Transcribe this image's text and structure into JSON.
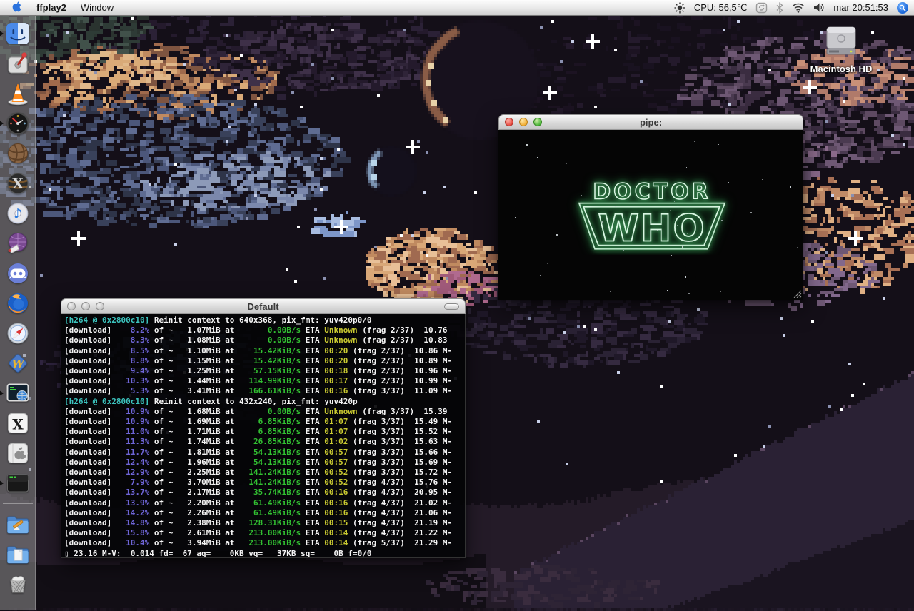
{
  "menubar": {
    "menus": [
      "ffplay2",
      "Window"
    ],
    "status": {
      "cpu": "CPU: 56,5℃",
      "clock": "mar 20:51:53"
    },
    "status_icons": [
      "brightness",
      "sync",
      "bluetooth",
      "wifi",
      "volume",
      "spotlight"
    ]
  },
  "desktop": {
    "hd_label": "Macintosh HD"
  },
  "dock": {
    "items": [
      "finder",
      "lever-app",
      "vlc",
      "gauge-monitor",
      "wicker-ball",
      "osx-tiger-x",
      "itunes",
      "purple-globe",
      "discord",
      "firefox",
      "safari",
      "w-app",
      "network-terminal",
      "x11",
      "apple-utility",
      "terminal",
      "applications-folder",
      "documents-folder",
      "trash"
    ],
    "running": [
      "finder",
      "gauge-monitor",
      "network-terminal",
      "terminal"
    ]
  },
  "terminal": {
    "title": "Default",
    "lines": [
      [
        {
          "t": "[h264 @ 0x2800c10]",
          "c": "c"
        },
        {
          "t": " Reinit context to 640x368, pix_fmt: yuv420p0/0",
          "c": "w"
        }
      ],
      [
        {
          "t": "[download] ",
          "c": "w"
        },
        {
          "t": "   8.2%",
          "c": "p"
        },
        {
          "t": " of ~ ",
          "c": "w"
        },
        {
          "t": "  1.07MiB",
          "c": "w"
        },
        {
          "t": " at ",
          "c": "w"
        },
        {
          "t": "      0.00B/s",
          "c": "g"
        },
        {
          "t": " ETA ",
          "c": "w"
        },
        {
          "t": "Unknown",
          "c": "y"
        },
        {
          "t": " (frag 2/37)  10.76",
          "c": "w"
        }
      ],
      [
        {
          "t": "[download] ",
          "c": "w"
        },
        {
          "t": "   8.3%",
          "c": "p"
        },
        {
          "t": " of ~ ",
          "c": "w"
        },
        {
          "t": "  1.08MiB",
          "c": "w"
        },
        {
          "t": " at ",
          "c": "w"
        },
        {
          "t": "      0.00B/s",
          "c": "g"
        },
        {
          "t": " ETA ",
          "c": "w"
        },
        {
          "t": "Unknown",
          "c": "y"
        },
        {
          "t": " (frag 2/37)  10.83",
          "c": "w"
        }
      ],
      [
        {
          "t": "[download] ",
          "c": "w"
        },
        {
          "t": "   8.5%",
          "c": "p"
        },
        {
          "t": " of ~ ",
          "c": "w"
        },
        {
          "t": "  1.10MiB",
          "c": "w"
        },
        {
          "t": " at ",
          "c": "w"
        },
        {
          "t": "   15.42KiB/s",
          "c": "g"
        },
        {
          "t": " ETA ",
          "c": "w"
        },
        {
          "t": "00:20",
          "c": "y"
        },
        {
          "t": " (frag 2/37)  10.86 M-",
          "c": "w"
        }
      ],
      [
        {
          "t": "[download] ",
          "c": "w"
        },
        {
          "t": "   8.8%",
          "c": "p"
        },
        {
          "t": " of ~ ",
          "c": "w"
        },
        {
          "t": "  1.15MiB",
          "c": "w"
        },
        {
          "t": " at ",
          "c": "w"
        },
        {
          "t": "   15.42KiB/s",
          "c": "g"
        },
        {
          "t": " ETA ",
          "c": "w"
        },
        {
          "t": "00:20",
          "c": "y"
        },
        {
          "t": " (frag 2/37)  10.89 M-",
          "c": "w"
        }
      ],
      [
        {
          "t": "[download] ",
          "c": "w"
        },
        {
          "t": "   9.4%",
          "c": "p"
        },
        {
          "t": " of ~ ",
          "c": "w"
        },
        {
          "t": "  1.25MiB",
          "c": "w"
        },
        {
          "t": " at ",
          "c": "w"
        },
        {
          "t": "   57.15KiB/s",
          "c": "g"
        },
        {
          "t": " ETA ",
          "c": "w"
        },
        {
          "t": "00:18",
          "c": "y"
        },
        {
          "t": " (frag 2/37)  10.96 M-",
          "c": "w"
        }
      ],
      [
        {
          "t": "[download] ",
          "c": "w"
        },
        {
          "t": "  10.3%",
          "c": "p"
        },
        {
          "t": " of ~ ",
          "c": "w"
        },
        {
          "t": "  1.44MiB",
          "c": "w"
        },
        {
          "t": " at ",
          "c": "w"
        },
        {
          "t": "  114.99KiB/s",
          "c": "g"
        },
        {
          "t": " ETA ",
          "c": "w"
        },
        {
          "t": "00:17",
          "c": "y"
        },
        {
          "t": " (frag 2/37)  10.99 M-",
          "c": "w"
        }
      ],
      [
        {
          "t": "[download] ",
          "c": "w"
        },
        {
          "t": "   5.3%",
          "c": "p"
        },
        {
          "t": " of ~ ",
          "c": "w"
        },
        {
          "t": "  3.41MiB",
          "c": "w"
        },
        {
          "t": " at ",
          "c": "w"
        },
        {
          "t": "  166.61KiB/s",
          "c": "g"
        },
        {
          "t": " ETA ",
          "c": "w"
        },
        {
          "t": "00:16",
          "c": "y"
        },
        {
          "t": " (frag 3/37)  11.09 M-",
          "c": "w"
        }
      ],
      [
        {
          "t": "[h264 @ 0x2800c10]",
          "c": "c"
        },
        {
          "t": " Reinit context to 432x240, pix_fmt: yuv420p",
          "c": "w"
        }
      ],
      [
        {
          "t": "[download] ",
          "c": "w"
        },
        {
          "t": "  10.9%",
          "c": "p"
        },
        {
          "t": " of ~ ",
          "c": "w"
        },
        {
          "t": "  1.68MiB",
          "c": "w"
        },
        {
          "t": " at ",
          "c": "w"
        },
        {
          "t": "      0.00B/s",
          "c": "g"
        },
        {
          "t": " ETA ",
          "c": "w"
        },
        {
          "t": "Unknown",
          "c": "y"
        },
        {
          "t": " (frag 3/37)  15.39",
          "c": "w"
        }
      ],
      [
        {
          "t": "[download] ",
          "c": "w"
        },
        {
          "t": "  10.9%",
          "c": "p"
        },
        {
          "t": " of ~ ",
          "c": "w"
        },
        {
          "t": "  1.69MiB",
          "c": "w"
        },
        {
          "t": " at ",
          "c": "w"
        },
        {
          "t": "    6.85KiB/s",
          "c": "g"
        },
        {
          "t": " ETA ",
          "c": "w"
        },
        {
          "t": "01:07",
          "c": "y"
        },
        {
          "t": " (frag 3/37)  15.49 M-",
          "c": "w"
        }
      ],
      [
        {
          "t": "[download] ",
          "c": "w"
        },
        {
          "t": "  11.0%",
          "c": "p"
        },
        {
          "t": " of ~ ",
          "c": "w"
        },
        {
          "t": "  1.71MiB",
          "c": "w"
        },
        {
          "t": " at ",
          "c": "w"
        },
        {
          "t": "    6.85KiB/s",
          "c": "g"
        },
        {
          "t": " ETA ",
          "c": "w"
        },
        {
          "t": "01:07",
          "c": "y"
        },
        {
          "t": " (frag 3/37)  15.52 M-",
          "c": "w"
        }
      ],
      [
        {
          "t": "[download] ",
          "c": "w"
        },
        {
          "t": "  11.3%",
          "c": "p"
        },
        {
          "t": " of ~ ",
          "c": "w"
        },
        {
          "t": "  1.74MiB",
          "c": "w"
        },
        {
          "t": " at ",
          "c": "w"
        },
        {
          "t": "   26.85KiB/s",
          "c": "g"
        },
        {
          "t": " ETA ",
          "c": "w"
        },
        {
          "t": "01:02",
          "c": "y"
        },
        {
          "t": " (frag 3/37)  15.63 M-",
          "c": "w"
        }
      ],
      [
        {
          "t": "[download] ",
          "c": "w"
        },
        {
          "t": "  11.7%",
          "c": "p"
        },
        {
          "t": " of ~ ",
          "c": "w"
        },
        {
          "t": "  1.81MiB",
          "c": "w"
        },
        {
          "t": " at ",
          "c": "w"
        },
        {
          "t": "   54.13KiB/s",
          "c": "g"
        },
        {
          "t": " ETA ",
          "c": "w"
        },
        {
          "t": "00:57",
          "c": "y"
        },
        {
          "t": " (frag 3/37)  15.66 M-",
          "c": "w"
        }
      ],
      [
        {
          "t": "[download] ",
          "c": "w"
        },
        {
          "t": "  12.4%",
          "c": "p"
        },
        {
          "t": " of ~ ",
          "c": "w"
        },
        {
          "t": "  1.96MiB",
          "c": "w"
        },
        {
          "t": " at ",
          "c": "w"
        },
        {
          "t": "   54.13KiB/s",
          "c": "g"
        },
        {
          "t": " ETA ",
          "c": "w"
        },
        {
          "t": "00:57",
          "c": "y"
        },
        {
          "t": " (frag 3/37)  15.69 M-",
          "c": "w"
        }
      ],
      [
        {
          "t": "[download] ",
          "c": "w"
        },
        {
          "t": "  12.9%",
          "c": "p"
        },
        {
          "t": " of ~ ",
          "c": "w"
        },
        {
          "t": "  2.25MiB",
          "c": "w"
        },
        {
          "t": " at ",
          "c": "w"
        },
        {
          "t": "  141.24KiB/s",
          "c": "g"
        },
        {
          "t": " ETA ",
          "c": "w"
        },
        {
          "t": "00:52",
          "c": "y"
        },
        {
          "t": " (frag 3/37)  15.72 M-",
          "c": "w"
        }
      ],
      [
        {
          "t": "[download] ",
          "c": "w"
        },
        {
          "t": "   7.9%",
          "c": "p"
        },
        {
          "t": " of ~ ",
          "c": "w"
        },
        {
          "t": "  3.70MiB",
          "c": "w"
        },
        {
          "t": " at ",
          "c": "w"
        },
        {
          "t": "  141.24KiB/s",
          "c": "g"
        },
        {
          "t": " ETA ",
          "c": "w"
        },
        {
          "t": "00:52",
          "c": "y"
        },
        {
          "t": " (frag 4/37)  15.76 M-",
          "c": "w"
        }
      ],
      [
        {
          "t": "[download] ",
          "c": "w"
        },
        {
          "t": "  13.7%",
          "c": "p"
        },
        {
          "t": " of ~ ",
          "c": "w"
        },
        {
          "t": "  2.17MiB",
          "c": "w"
        },
        {
          "t": " at ",
          "c": "w"
        },
        {
          "t": "   35.74KiB/s",
          "c": "g"
        },
        {
          "t": " ETA ",
          "c": "w"
        },
        {
          "t": "00:16",
          "c": "y"
        },
        {
          "t": " (frag 4/37)  20.95 M-",
          "c": "w"
        }
      ],
      [
        {
          "t": "[download] ",
          "c": "w"
        },
        {
          "t": "  13.9%",
          "c": "p"
        },
        {
          "t": " of ~ ",
          "c": "w"
        },
        {
          "t": "  2.20MiB",
          "c": "w"
        },
        {
          "t": " at ",
          "c": "w"
        },
        {
          "t": "   61.49KiB/s",
          "c": "g"
        },
        {
          "t": " ETA ",
          "c": "w"
        },
        {
          "t": "00:16",
          "c": "y"
        },
        {
          "t": " (frag 4/37)  21.02 M-",
          "c": "w"
        }
      ],
      [
        {
          "t": "[download] ",
          "c": "w"
        },
        {
          "t": "  14.2%",
          "c": "p"
        },
        {
          "t": " of ~ ",
          "c": "w"
        },
        {
          "t": "  2.26MiB",
          "c": "w"
        },
        {
          "t": " at ",
          "c": "w"
        },
        {
          "t": "   61.49KiB/s",
          "c": "g"
        },
        {
          "t": " ETA ",
          "c": "w"
        },
        {
          "t": "00:16",
          "c": "y"
        },
        {
          "t": " (frag 4/37)  21.06 M-",
          "c": "w"
        }
      ],
      [
        {
          "t": "[download] ",
          "c": "w"
        },
        {
          "t": "  14.8%",
          "c": "p"
        },
        {
          "t": " of ~ ",
          "c": "w"
        },
        {
          "t": "  2.38MiB",
          "c": "w"
        },
        {
          "t": " at ",
          "c": "w"
        },
        {
          "t": "  128.31KiB/s",
          "c": "g"
        },
        {
          "t": " ETA ",
          "c": "w"
        },
        {
          "t": "00:15",
          "c": "y"
        },
        {
          "t": " (frag 4/37)  21.19 M-",
          "c": "w"
        }
      ],
      [
        {
          "t": "[download] ",
          "c": "w"
        },
        {
          "t": "  15.8%",
          "c": "p"
        },
        {
          "t": " of ~ ",
          "c": "w"
        },
        {
          "t": "  2.61MiB",
          "c": "w"
        },
        {
          "t": " at ",
          "c": "w"
        },
        {
          "t": "  213.00KiB/s",
          "c": "g"
        },
        {
          "t": " ETA ",
          "c": "w"
        },
        {
          "t": "00:14",
          "c": "y"
        },
        {
          "t": " (frag 4/37)  21.22 M-",
          "c": "w"
        }
      ],
      [
        {
          "t": "[download] ",
          "c": "w"
        },
        {
          "t": "  10.4%",
          "c": "p"
        },
        {
          "t": " of ~ ",
          "c": "w"
        },
        {
          "t": "  3.94MiB",
          "c": "w"
        },
        {
          "t": " at ",
          "c": "w"
        },
        {
          "t": "  213.00KiB/s",
          "c": "g"
        },
        {
          "t": " ETA ",
          "c": "w"
        },
        {
          "t": "00:14",
          "c": "y"
        },
        {
          "t": " (frag 5/37)  21.29 M-",
          "c": "w"
        }
      ],
      [
        {
          "t": "▯ 23.16 M-V:  0.014 fd=  67 aq=    0KB vq=   37KB sq=    0B f=0/0",
          "c": "w"
        }
      ]
    ]
  },
  "video": {
    "title": "pipe:",
    "logo_top": "DOCTOR",
    "logo_bottom": "WHO"
  }
}
